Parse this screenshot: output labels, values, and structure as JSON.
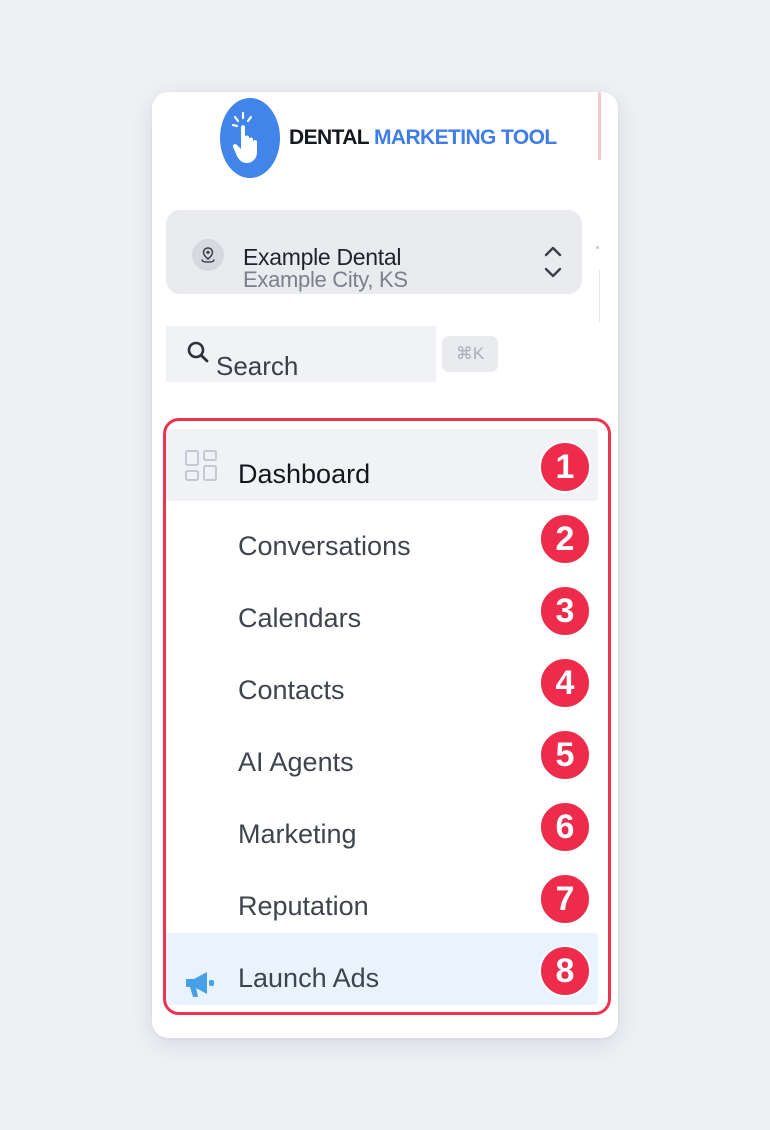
{
  "brand": {
    "name_dark": "DENTAL",
    "name_blue": "MARKETING TOOL",
    "logo_icon": "pointing-hand-icon"
  },
  "location": {
    "name": "Example Dental",
    "city": "Example City, KS"
  },
  "search": {
    "placeholder": "Search",
    "shortcut": "⌘K"
  },
  "nav": {
    "items": [
      {
        "label": "Dashboard",
        "badge": "1"
      },
      {
        "label": "Conversations",
        "badge": "2"
      },
      {
        "label": "Calendars",
        "badge": "3"
      },
      {
        "label": "Contacts",
        "badge": "4"
      },
      {
        "label": "AI Agents",
        "badge": "5"
      },
      {
        "label": "Marketing",
        "badge": "6"
      },
      {
        "label": "Reputation",
        "badge": "7"
      },
      {
        "label": "Launch Ads",
        "badge": "8"
      }
    ]
  },
  "colors": {
    "accent_blue": "#4285ea",
    "highlight_red": "#ee3350",
    "launch_bg": "#e8f3fd"
  }
}
